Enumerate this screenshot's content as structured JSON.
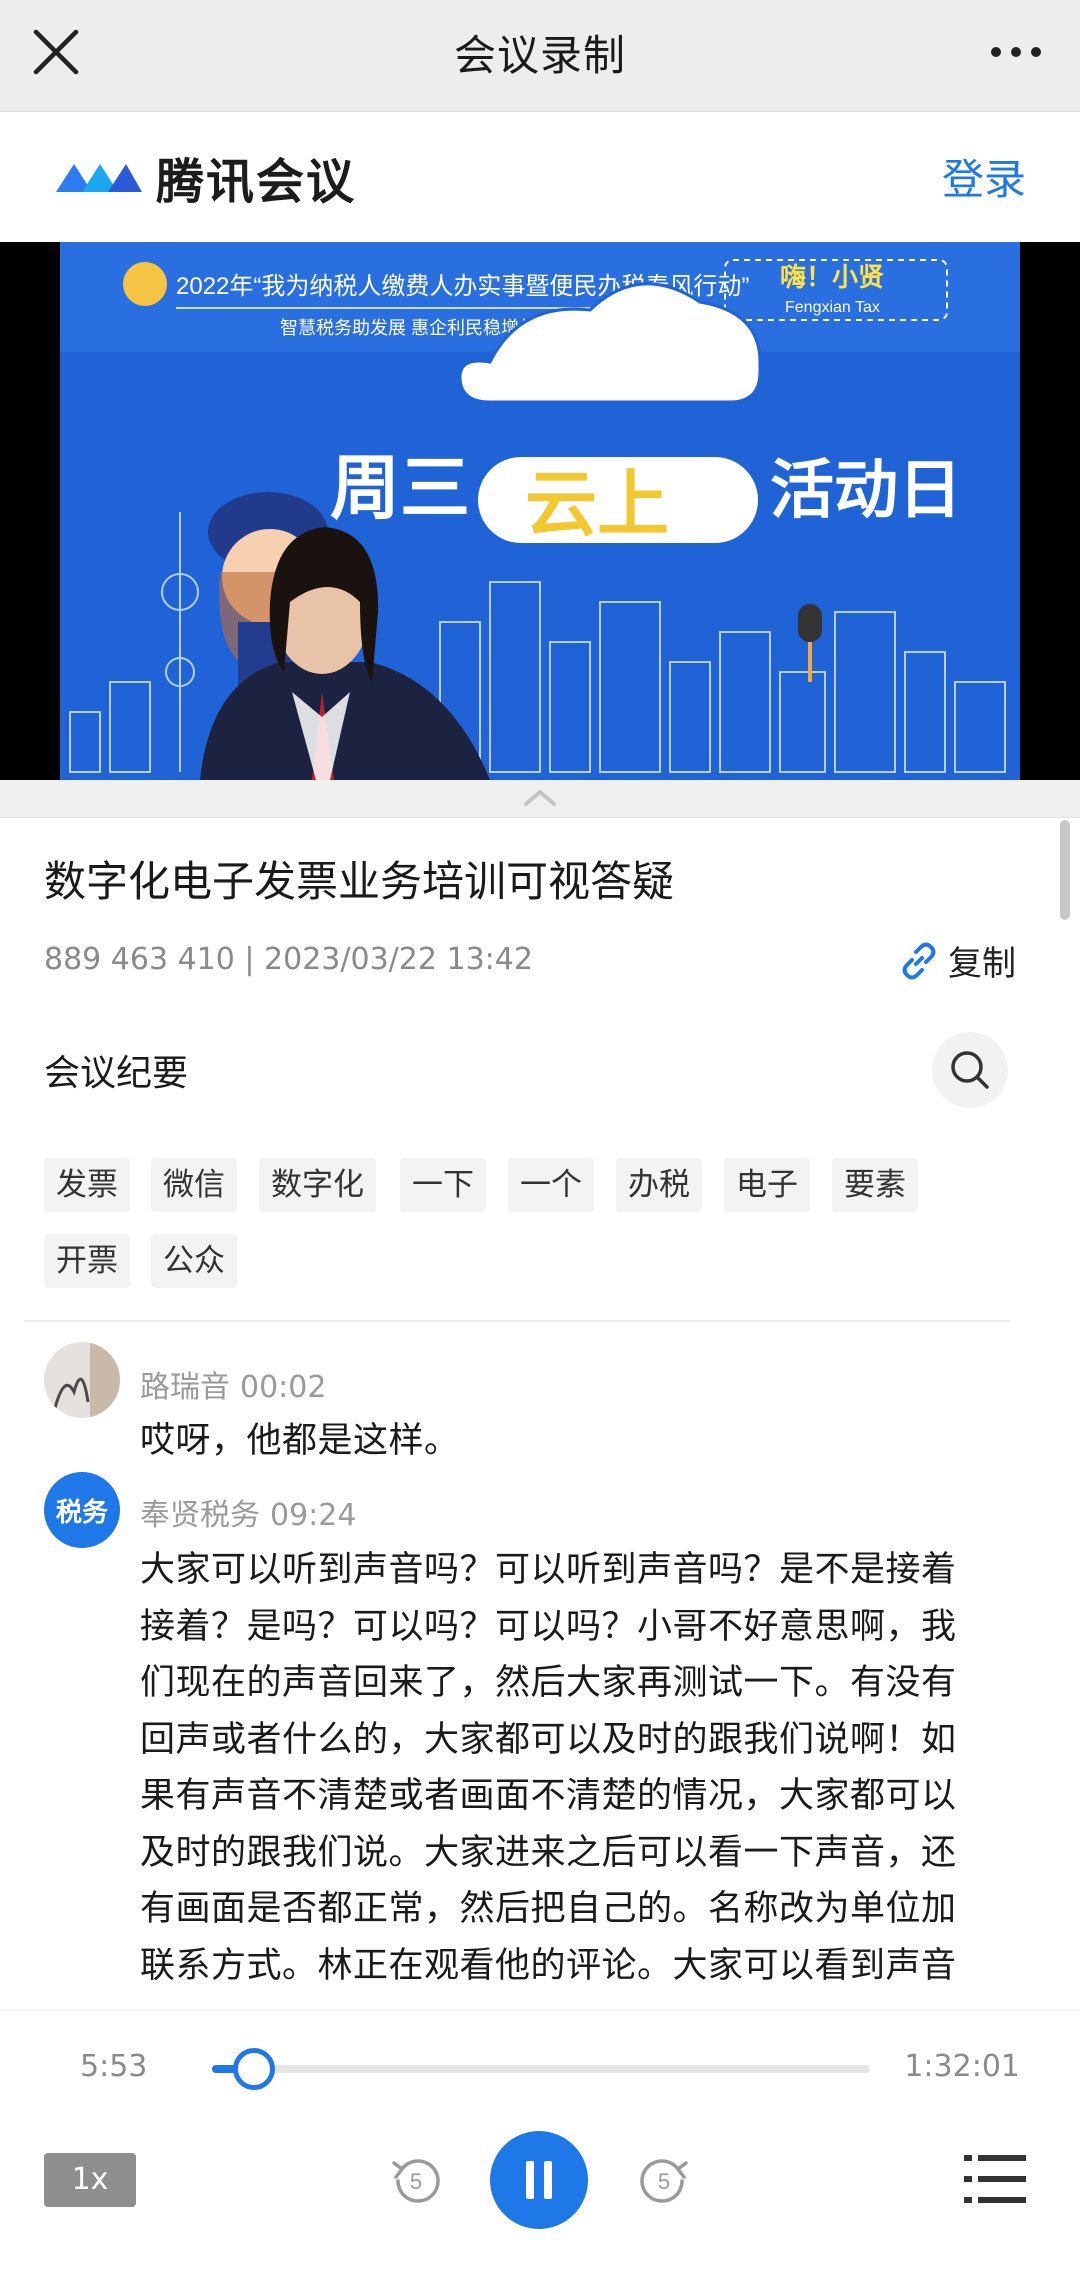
{
  "titlebar": {
    "title": "会议录制",
    "close_icon": "close-icon",
    "more_icon": "more-icon"
  },
  "brand": {
    "name": "腾讯会议",
    "login": "登录",
    "logo_icon": "tencent-meeting-logo"
  },
  "video": {
    "campaign": "2022年“我为纳税人缴费人办实事暨便民办税春风行动”",
    "slogan": "智慧税务助发展 惠企利民稳增长",
    "event_prefix": "周三",
    "event_cloud": "云上",
    "event_suffix": "活动日",
    "badge_title": "嗨！小贤",
    "badge_sub": "Fengxian Tax",
    "accent": "#1f63d6"
  },
  "meeting": {
    "title": "数字化电子发票业务培训可视答疑",
    "info": "889 463 410 | 2023/03/22 13:42",
    "copy_label": "复制",
    "summary_label": "会议纪要",
    "tags": [
      "发票",
      "微信",
      "数字化",
      "一下",
      "一个",
      "办税",
      "电子",
      "要素",
      "开票",
      "公众"
    ]
  },
  "transcript": [
    {
      "speaker": "路瑞音",
      "time": "00:02",
      "text": "哎呀，他都是这样。"
    },
    {
      "speaker": "奉贤税务",
      "time": "09:24",
      "avatar_text": "税务",
      "lines": [
        "大家可以听到声音吗？可以听到声音吗？是不是接着",
        "接着？是吗？可以吗？可以吗？小哥不好意思啊，我",
        "们现在的声音回来了，然后大家再测试一下。有没有",
        "回声或者什么的，大家都可以及时的跟我们说啊！如",
        "果有声音不清楚或者画面不清楚的情况，大家都可以",
        "及时的跟我们说。大家进来之后可以看一下声音，还",
        "有画面是否都正常，然后把自己的。名称改为单位加",
        "联系方式。林正在观看他的评论。大家可以看到声音"
      ]
    }
  ],
  "player": {
    "current": "5:53",
    "total": "1:32:01",
    "progress": 0.064,
    "speed": "1x",
    "skip_back": "5",
    "skip_forward": "5",
    "state": "playing",
    "accent": "#1f78e8"
  }
}
